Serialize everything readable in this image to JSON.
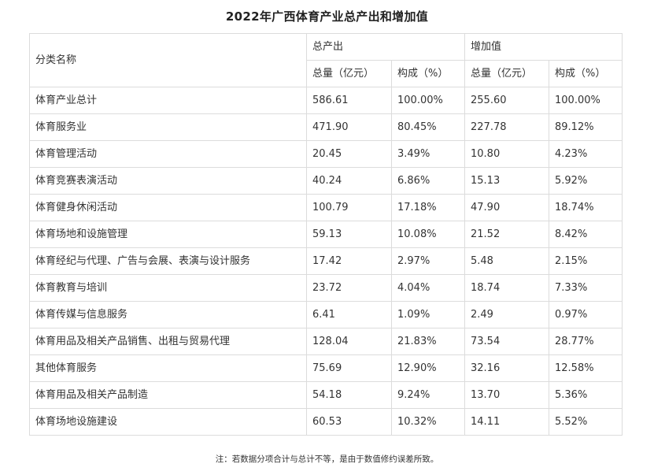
{
  "title": "2022年广西体育产业总产出和增加值",
  "table": {
    "header": {
      "category": "分类名称",
      "group_output": "总产出",
      "group_value_added": "增加值",
      "sub_total": "总量（亿元）",
      "sub_share": "构成（%）"
    },
    "rows": [
      {
        "name": "体育产业总计",
        "output_total": "586.61",
        "output_share": "100.00%",
        "va_total": "255.60",
        "va_share": "100.00%"
      },
      {
        "name": "体育服务业",
        "output_total": "471.90",
        "output_share": "80.45%",
        "va_total": "227.78",
        "va_share": "89.12%"
      },
      {
        "name": "体育管理活动",
        "output_total": "20.45",
        "output_share": "3.49%",
        "va_total": "10.80",
        "va_share": "4.23%"
      },
      {
        "name": "体育竞赛表演活动",
        "output_total": "40.24",
        "output_share": "6.86%",
        "va_total": "15.13",
        "va_share": "5.92%"
      },
      {
        "name": "体育健身休闲活动",
        "output_total": "100.79",
        "output_share": "17.18%",
        "va_total": "47.90",
        "va_share": "18.74%"
      },
      {
        "name": "体育场地和设施管理",
        "output_total": "59.13",
        "output_share": "10.08%",
        "va_total": "21.52",
        "va_share": "8.42%"
      },
      {
        "name": "体育经纪与代理、广告与会展、表演与设计服务",
        "output_total": "17.42",
        "output_share": "2.97%",
        "va_total": "5.48",
        "va_share": "2.15%"
      },
      {
        "name": "体育教育与培训",
        "output_total": "23.72",
        "output_share": "4.04%",
        "va_total": "18.74",
        "va_share": "7.33%"
      },
      {
        "name": "体育传媒与信息服务",
        "output_total": "6.41",
        "output_share": "1.09%",
        "va_total": "2.49",
        "va_share": "0.97%"
      },
      {
        "name": "体育用品及相关产品销售、出租与贸易代理",
        "output_total": "128.04",
        "output_share": "21.83%",
        "va_total": "73.54",
        "va_share": "28.77%"
      },
      {
        "name": "其他体育服务",
        "output_total": "75.69",
        "output_share": "12.90%",
        "va_total": "32.16",
        "va_share": "12.58%"
      },
      {
        "name": "体育用品及相关产品制造",
        "output_total": "54.18",
        "output_share": "9.24%",
        "va_total": "13.70",
        "va_share": "5.36%"
      },
      {
        "name": "体育场地设施建设",
        "output_total": "60.53",
        "output_share": "10.32%",
        "va_total": "14.11",
        "va_share": "5.52%"
      }
    ]
  },
  "footnote": "注：若数据分项合计与总计不等，是由于数值修约误差所致。",
  "colors": {
    "border": "#dcdcdc",
    "text": "#333333",
    "title": "#222222"
  }
}
